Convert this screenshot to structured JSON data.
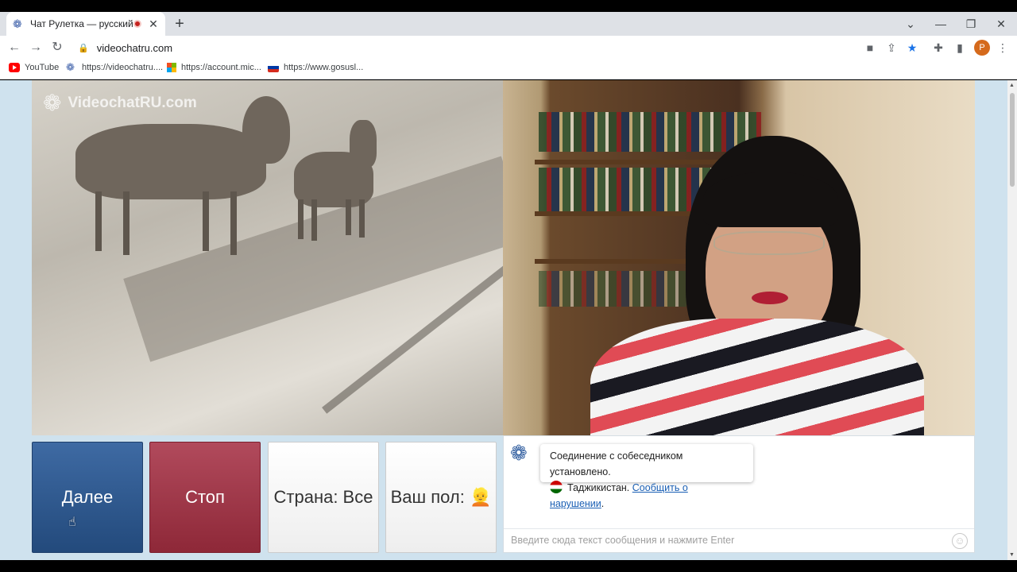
{
  "browser": {
    "tab": {
      "title": "Чат Рулетка — русский вид",
      "favicon": "videochat-logo-icon"
    },
    "new_tab": "+",
    "window_controls": {
      "dropdown": "⌄",
      "minimize": "—",
      "restore": "❐",
      "close": "✕"
    },
    "nav": {
      "back": "←",
      "forward": "→",
      "reload": "↻"
    },
    "address": "videochatru.com",
    "profile_initial": "P",
    "bookmarks": [
      {
        "label": "YouTube",
        "icon": "youtube-icon"
      },
      {
        "label": "https://videochatru....",
        "icon": "videochat-logo-icon"
      },
      {
        "label": "https://account.mic...",
        "icon": "microsoft-icon"
      },
      {
        "label": "https://www.gosusl...",
        "icon": "gosuslugi-icon"
      }
    ]
  },
  "page": {
    "watermark": "VideochatRU.com",
    "buttons": {
      "next": "Далее",
      "stop": "Стоп",
      "country": "Страна: Все",
      "gender": "Ваш пол: 👱"
    },
    "chat": {
      "system_message": "Соединение с собеседником установлено.",
      "country": "Таджикистан.",
      "report_link": "Сообщить о нарушении",
      "report_suffix": ".",
      "input_placeholder": "Введите сюда текст сообщения и нажмите Enter"
    }
  },
  "colors": {
    "next_button": "#2d578e",
    "stop_button": "#9e3546",
    "page_background": "#cfe2ee",
    "link": "#1a5fb4"
  }
}
